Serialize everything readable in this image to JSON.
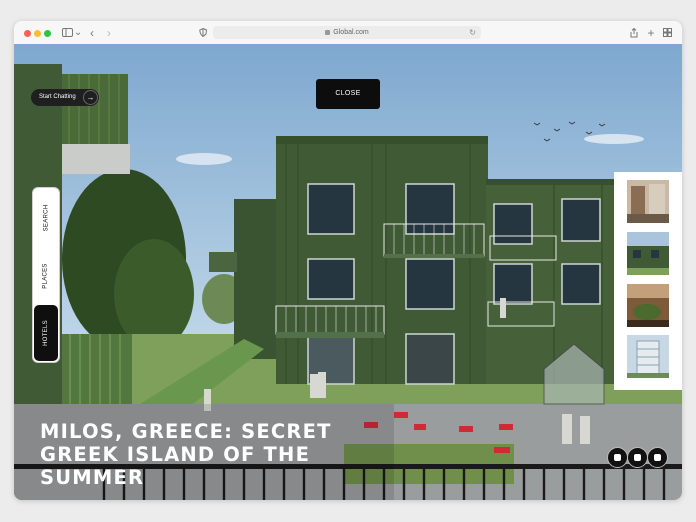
{
  "browser": {
    "url": "Global.com"
  },
  "chat": {
    "label": "Start Chatting"
  },
  "close": {
    "label": "CLOSE"
  },
  "nav": {
    "items": [
      {
        "label": "SEARCH"
      },
      {
        "label": "PLACES"
      },
      {
        "label": "HOTELS"
      }
    ],
    "active": "HOTELS"
  },
  "hero": {
    "headline": "MILOS, GREECE: SECRET GREEK ISLAND OF THE SUMMER"
  },
  "social": [
    "facebook-icon",
    "instagram-icon",
    "youtube-icon"
  ],
  "colors": {
    "building_green": "#3f5a34",
    "sky": "#9fc0dd",
    "chat_button": "#1f1f1f",
    "close_button": "#0d0d0d",
    "active_tab": "#0f0f0f"
  }
}
